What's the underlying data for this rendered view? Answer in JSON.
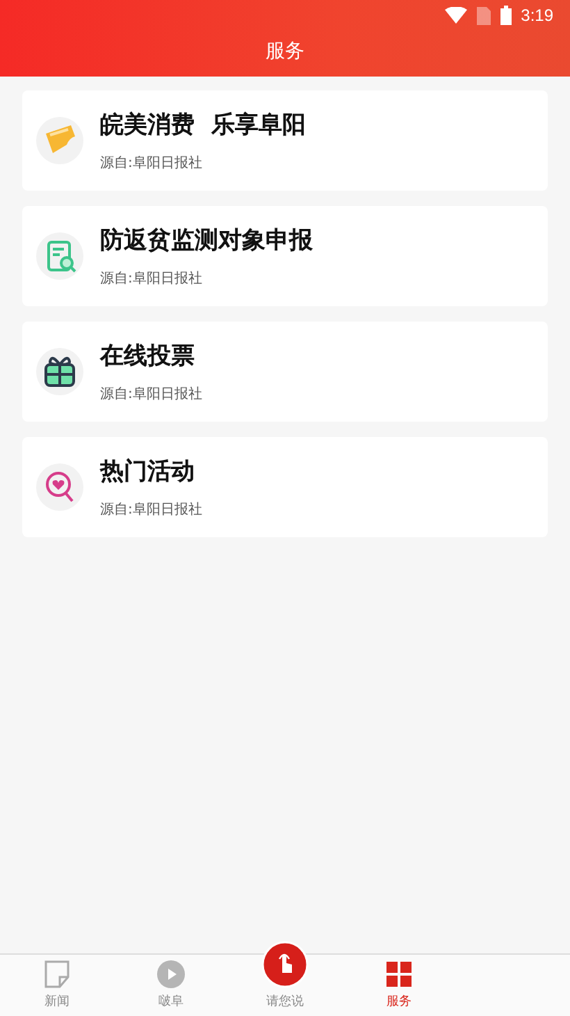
{
  "status_bar": {
    "time": "3:19"
  },
  "header": {
    "title": "服务"
  },
  "services": [
    {
      "kind": "ticket",
      "title": "皖美消费  乐享阜阳",
      "source": "源自:阜阳日报社"
    },
    {
      "kind": "document-search",
      "title": "防返贫监测对象申报",
      "source": "源自:阜阳日报社"
    },
    {
      "kind": "gift",
      "title": "在线投票",
      "source": "源自:阜阳日报社"
    },
    {
      "kind": "heart-search",
      "title": "热门活动",
      "source": "源自:阜阳日报社"
    }
  ],
  "tab_bar": [
    {
      "kind": "page",
      "label": "新闻",
      "selected": false
    },
    {
      "kind": "play",
      "label": "啵阜",
      "selected": false
    },
    {
      "kind": "center",
      "label": "请您说",
      "selected": false
    },
    {
      "kind": "service",
      "label": "服务",
      "selected": true
    }
  ]
}
